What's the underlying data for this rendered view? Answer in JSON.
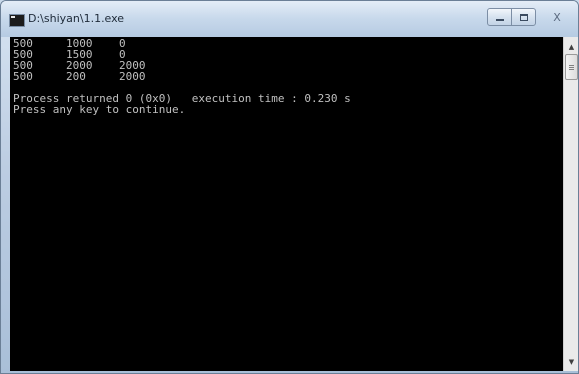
{
  "window": {
    "title": "D:\\shiyan\\1.1.exe",
    "controls": {
      "minimize_icon": "minimize-icon",
      "maximize_icon": "maximize-icon",
      "close_icon": "close-icon",
      "close_glyph": "X"
    }
  },
  "console": {
    "background": "#000000",
    "foreground": "#c0c0c0",
    "lines": [
      "500     1000    0",
      "500     1500    0",
      "500     2000    2000",
      "500     200     2000",
      "",
      "Process returned 0 (0x0)   execution time : 0.230 s",
      "Press any key to continue."
    ]
  },
  "scrollbar": {
    "up_icon": "scroll-up-arrow-icon",
    "down_icon": "scroll-down-arrow-icon",
    "up_glyph": "▲",
    "down_glyph": "▼"
  }
}
